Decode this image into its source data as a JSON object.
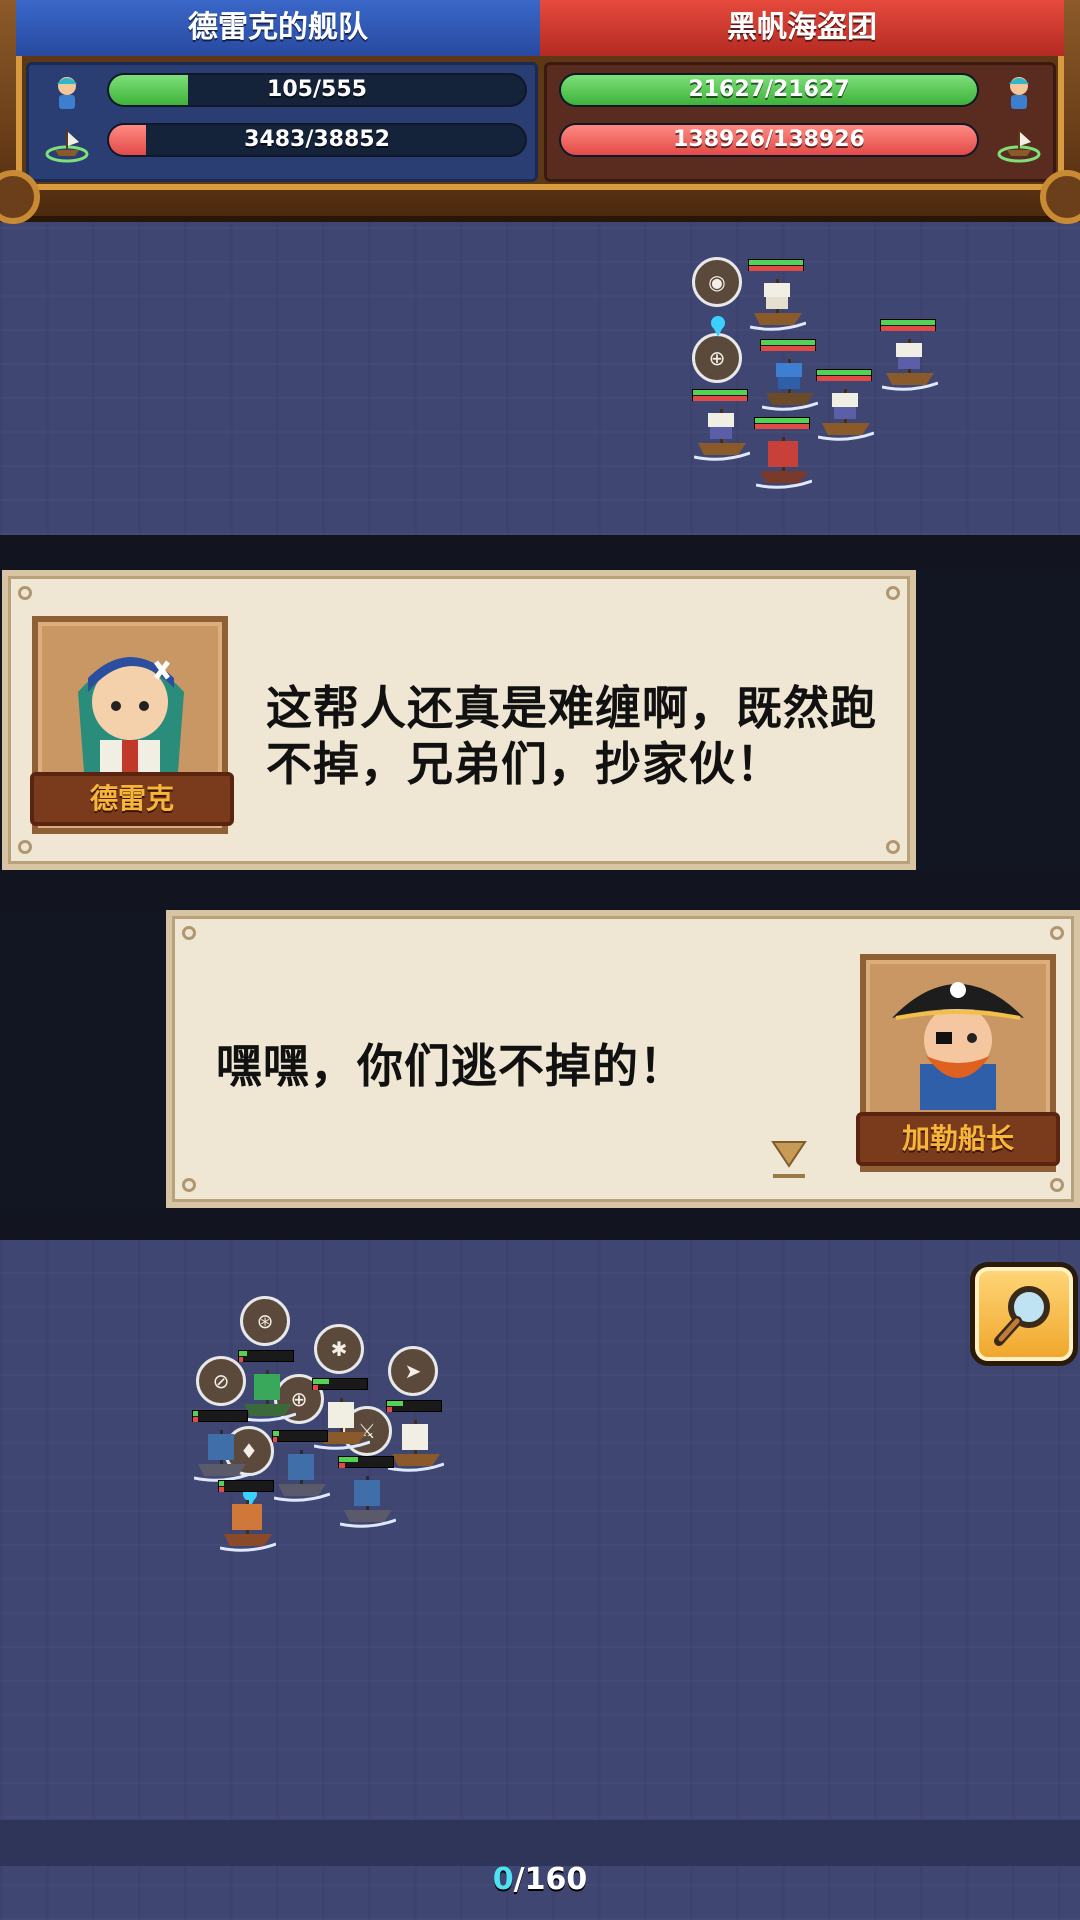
{
  "hud": {
    "left_team": "德雷克的舰队",
    "right_team": "黑帆海盗团",
    "left_stats": [
      {
        "icon": "sailor-icon",
        "value": "105/555",
        "fill": 0.19,
        "color": "green"
      },
      {
        "icon": "ship-icon",
        "value": "3483/38852",
        "fill": 0.09,
        "color": "red"
      }
    ],
    "right_stats": [
      {
        "icon": "sailor-icon",
        "value": "21627/21627",
        "fill": 1.0,
        "color": "green"
      },
      {
        "icon": "ship-icon",
        "value": "138926/138926",
        "fill": 1.0,
        "color": "red"
      }
    ]
  },
  "dialogs": [
    {
      "speaker": "德雷克",
      "line1": "这帮人还真是难缠啊，既然跑",
      "line2": "不掉，兄弟们，抄家伙！"
    },
    {
      "speaker": "加勒船长",
      "line1": "嘿嘿，你们逃不掉的！",
      "line2": ""
    }
  ],
  "counter": {
    "current": "0",
    "total": "/160"
  },
  "colors": {
    "hp_green": "#53d356",
    "hp_red": "#e24a48",
    "accent_cyan": "#4fe2f2",
    "nameplate_text": "#f7b63a"
  }
}
